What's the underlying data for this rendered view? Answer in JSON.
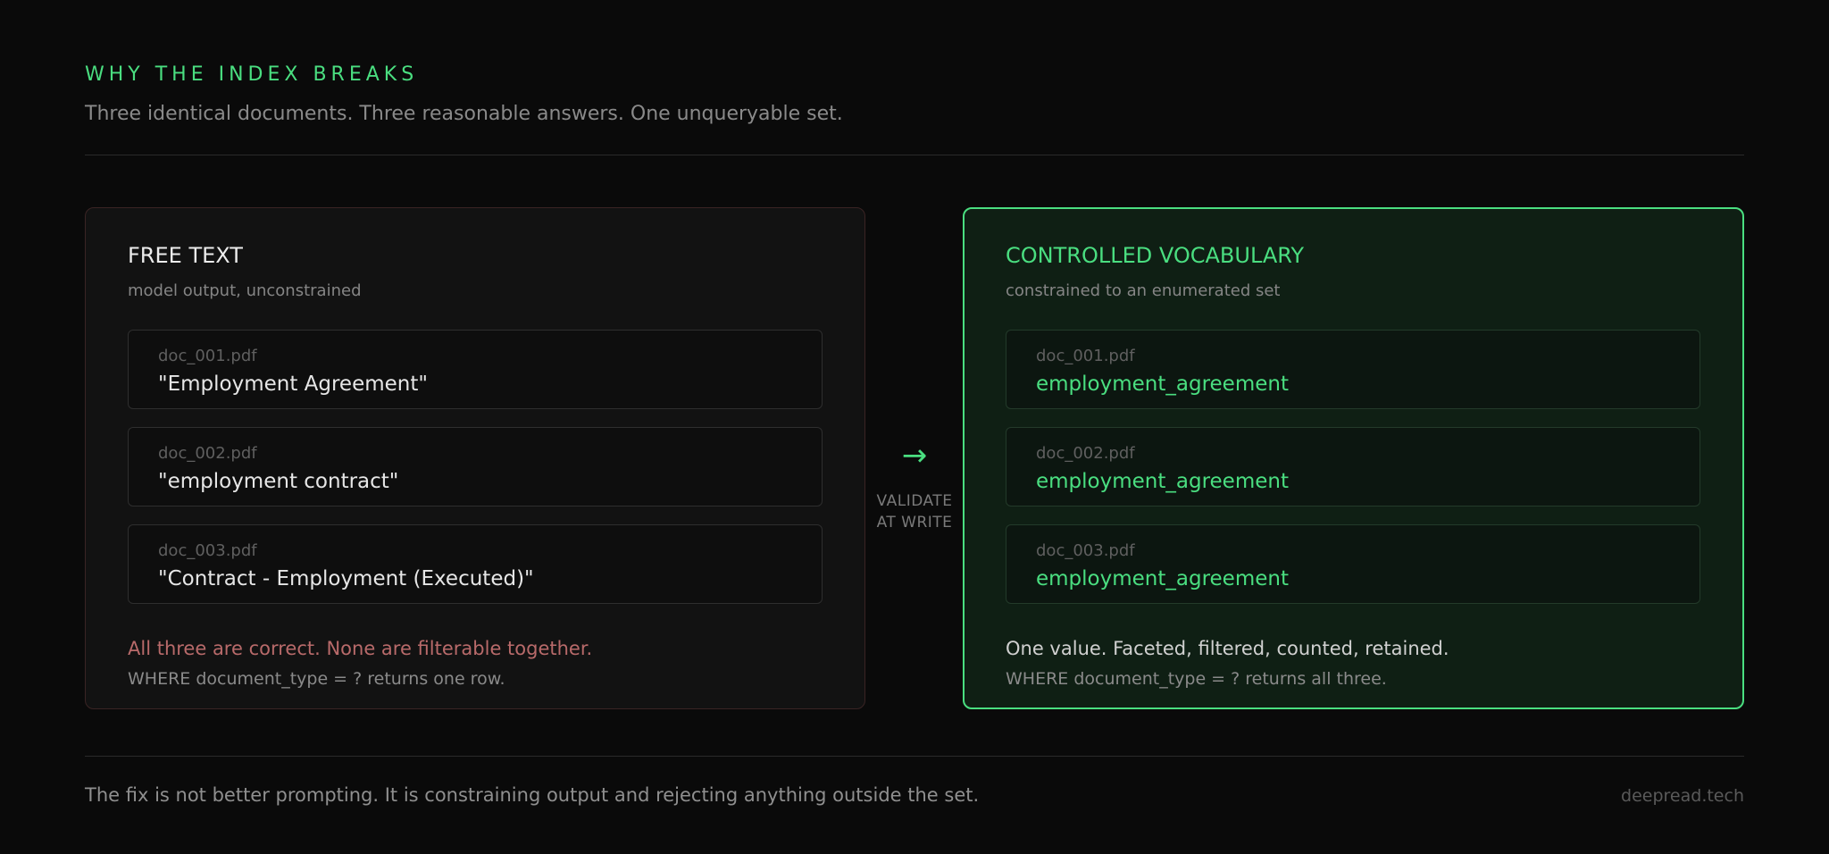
{
  "header": {
    "eyebrow": "WHY THE INDEX BREAKS",
    "subtitle": "Three identical documents. Three reasonable answers. One unqueryable set."
  },
  "free_text": {
    "title": "FREE TEXT",
    "subtitle": "model output, unconstrained",
    "docs": [
      {
        "file": "doc_001.pdf",
        "value": "\"Employment Agreement\""
      },
      {
        "file": "doc_002.pdf",
        "value": "\"employment contract\""
      },
      {
        "file": "doc_003.pdf",
        "value": "\"Contract - Employment (Executed)\""
      }
    ],
    "note": "All three are correct. None are filterable together.",
    "query": "WHERE document_type = ? returns one row."
  },
  "transition": {
    "arrow": "→",
    "label_line1": "VALIDATE",
    "label_line2": "AT WRITE"
  },
  "controlled": {
    "title": "CONTROLLED VOCABULARY",
    "subtitle": "constrained to an enumerated set",
    "docs": [
      {
        "file": "doc_001.pdf",
        "value": "employment_agreement"
      },
      {
        "file": "doc_002.pdf",
        "value": "employment_agreement"
      },
      {
        "file": "doc_003.pdf",
        "value": "employment_agreement"
      }
    ],
    "note": "One value. Faceted, filtered, counted, retained.",
    "query": "WHERE document_type = ? returns all three."
  },
  "footer": {
    "text": "The fix is not better prompting. It is constraining output and rejecting anything outside the set.",
    "brand": "deepread.tech"
  },
  "colors": {
    "accent": "#4ade80",
    "error": "#b86a6a",
    "background": "#0a0a0a"
  }
}
